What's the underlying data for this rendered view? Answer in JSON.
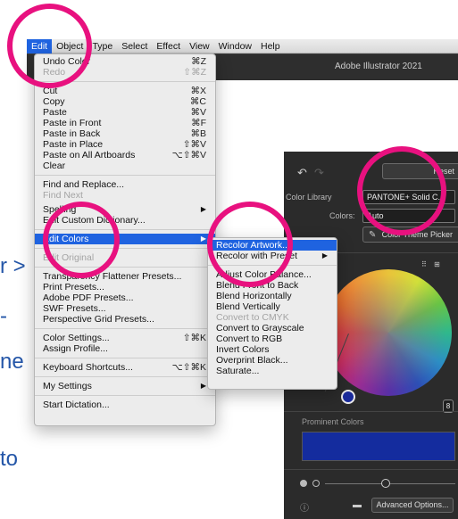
{
  "menubar": {
    "items": [
      "Edit",
      "Object",
      "Type",
      "Select",
      "Effect",
      "View",
      "Window",
      "Help"
    ],
    "app_title": "Adobe Illustrator 2021"
  },
  "slide_text": {
    "line1": "r >",
    "line2": "-",
    "line3": "ne",
    "line4": "to"
  },
  "edit_menu": {
    "items": [
      {
        "label": "Undo Color",
        "shortcut": "⌘Z",
        "disabled": false
      },
      {
        "label": "Redo",
        "shortcut": "⇧⌘Z",
        "disabled": true
      },
      {
        "label": "Cut",
        "shortcut": "⌘X",
        "disabled": false
      },
      {
        "label": "Copy",
        "shortcut": "⌘C",
        "disabled": false
      },
      {
        "label": "Paste",
        "shortcut": "⌘V",
        "disabled": false
      },
      {
        "label": "Paste in Front",
        "shortcut": "⌘F",
        "disabled": false
      },
      {
        "label": "Paste in Back",
        "shortcut": "⌘B",
        "disabled": false
      },
      {
        "label": "Paste in Place",
        "shortcut": "⇧⌘V",
        "disabled": false
      },
      {
        "label": "Paste on All Artboards",
        "shortcut": "⌥⇧⌘V",
        "disabled": false
      },
      {
        "label": "Clear",
        "shortcut": "",
        "disabled": false
      },
      {
        "label": "Find and Replace...",
        "shortcut": "",
        "disabled": false
      },
      {
        "label": "Find Next",
        "shortcut": "",
        "disabled": true
      },
      {
        "label": "Spelling",
        "shortcut": "",
        "disabled": false,
        "submenu": true
      },
      {
        "label": "Edit Custom Dictionary...",
        "shortcut": "",
        "disabled": false
      },
      {
        "label": "Edit Colors",
        "shortcut": "",
        "disabled": false,
        "submenu": true,
        "highlighted": true
      },
      {
        "label": "Edit Original",
        "shortcut": "",
        "disabled": true
      },
      {
        "label": "Transparency Flattener Presets...",
        "shortcut": "",
        "disabled": false
      },
      {
        "label": "Print Presets...",
        "shortcut": "",
        "disabled": false
      },
      {
        "label": "Adobe PDF Presets...",
        "shortcut": "",
        "disabled": false
      },
      {
        "label": "SWF Presets...",
        "shortcut": "",
        "disabled": false
      },
      {
        "label": "Perspective Grid Presets...",
        "shortcut": "",
        "disabled": false
      },
      {
        "label": "Color Settings...",
        "shortcut": "⇧⌘K",
        "disabled": false
      },
      {
        "label": "Assign Profile...",
        "shortcut": "",
        "disabled": false
      },
      {
        "label": "Keyboard Shortcuts...",
        "shortcut": "⌥⇧⌘K",
        "disabled": false
      },
      {
        "label": "My Settings",
        "shortcut": "",
        "disabled": false,
        "submenu": true
      },
      {
        "label": "Start Dictation...",
        "shortcut": "",
        "disabled": false
      }
    ],
    "arrow": "▶"
  },
  "edit_colors_submenu": {
    "items": [
      {
        "label": "Recolor Artwork...",
        "highlighted": true,
        "disabled": false
      },
      {
        "label": "Recolor with Preset",
        "disabled": false,
        "submenu": true
      },
      {
        "label": "Adjust Color Balance...",
        "disabled": false
      },
      {
        "label": "Blend Front to Back",
        "disabled": false
      },
      {
        "label": "Blend Horizontally",
        "disabled": false
      },
      {
        "label": "Blend Vertically",
        "disabled": false
      },
      {
        "label": "Convert to CMYK",
        "disabled": true
      },
      {
        "label": "Convert to Grayscale",
        "disabled": false
      },
      {
        "label": "Convert to RGB",
        "disabled": false
      },
      {
        "label": "Invert Colors",
        "disabled": false
      },
      {
        "label": "Overprint Black...",
        "disabled": false
      },
      {
        "label": "Saturate...",
        "disabled": false
      }
    ]
  },
  "recolor_panel": {
    "undo_icon": "↶",
    "redo_icon": "↷",
    "reset_label": "Reset",
    "color_library_label": "Color Library",
    "color_library_value": "PANTONE+ Solid C...",
    "colors_label": "Colors:",
    "colors_value": "Auto",
    "picker_label": "Color Theme Picker",
    "picker_icon": "✎",
    "wheel_icons": "⠿ ⊞",
    "link_icon": "8",
    "prominent_colors_label": "Prominent Colors",
    "swatch_color": "#142c9e",
    "info_icon": "ⓘ",
    "folder_icon": "▬",
    "advanced_label": "Advanced Options..."
  },
  "colors": {
    "accent": "#1f63e0",
    "highlight_circle": "#e8117f",
    "slide_text": "#2456a8"
  }
}
